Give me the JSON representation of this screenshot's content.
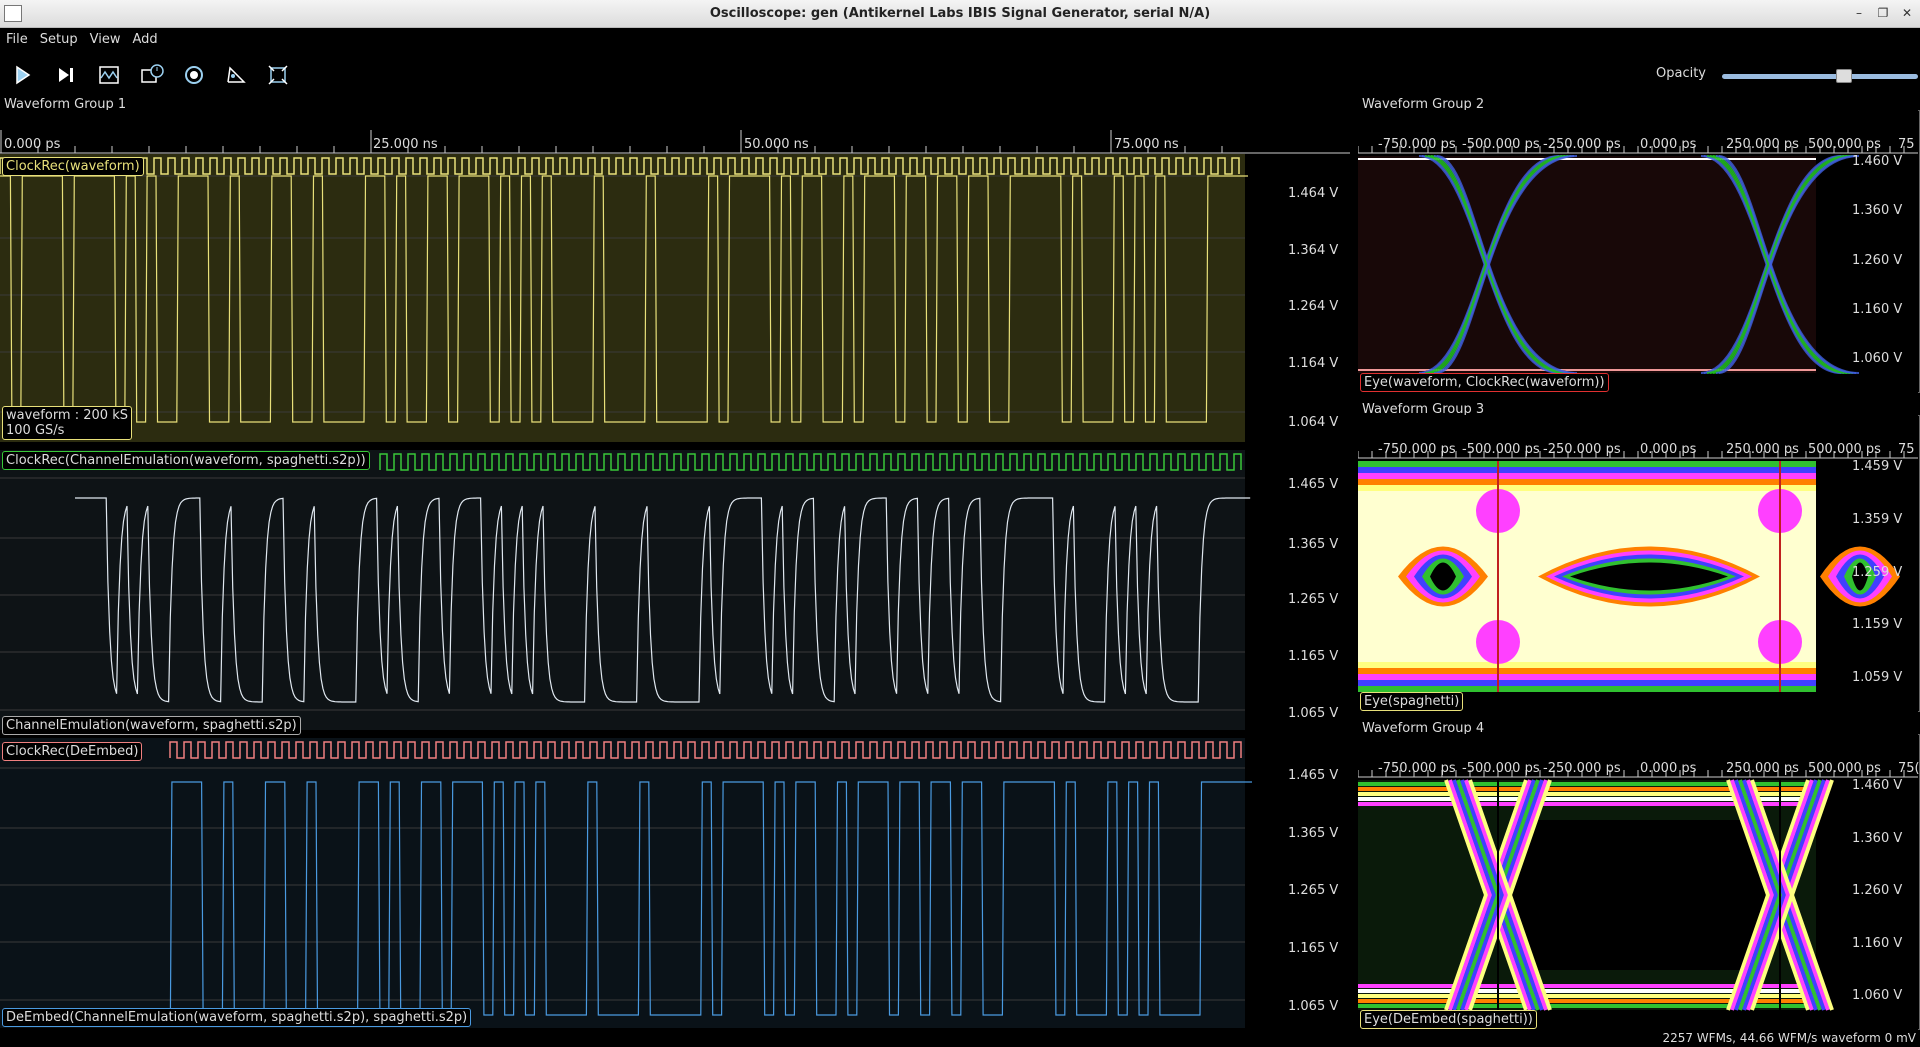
{
  "window": {
    "title": "Oscilloscope: gen (Antikernel Labs IBIS Signal Generator, serial N/A)"
  },
  "menu": [
    "File",
    "Setup",
    "View",
    "Add"
  ],
  "toolbar": {
    "buttons": [
      "play-icon",
      "step-icon",
      "waveform-icon",
      "clock-icon",
      "record-icon",
      "history-icon",
      "fullscreen-icon"
    ],
    "opacity_label": "Opacity",
    "opacity_value": 0.62
  },
  "colors": {
    "yellow": "#e8e07a",
    "green": "#38c838",
    "white": "#e0e8f0",
    "salmon": "#f08080",
    "blue": "#4a9ae0"
  },
  "group1": {
    "title": "Waveform Group 1",
    "time_labels": [
      "0.000 ps",
      "25.000 ns",
      "50.000 ns",
      "75.000 ns"
    ],
    "panes": [
      {
        "clock_label": "ClockRec(waveform)",
        "info_label_1": "waveform : 200 kS",
        "info_label_2": "100 GS/s",
        "volts": [
          "1.464 V",
          "1.364 V",
          "1.264 V",
          "1.164 V",
          "1.064 V"
        ]
      },
      {
        "clock_label": "ClockRec(ChannelEmulation(waveform, spaghetti.s2p))",
        "trace_label": "ChannelEmulation(waveform, spaghetti.s2p)",
        "volts": [
          "1.465 V",
          "1.365 V",
          "1.265 V",
          "1.165 V",
          "1.065 V"
        ]
      },
      {
        "clock_label": "ClockRec(DeEmbed)",
        "trace_label": "DeEmbed(ChannelEmulation(waveform, spaghetti.s2p), spaghetti.s2p)",
        "volts": [
          "1.465 V",
          "1.365 V",
          "1.265 V",
          "1.165 V",
          "1.065 V"
        ]
      }
    ]
  },
  "eye_groups": [
    {
      "title": "Waveform Group 2",
      "time_labels": [
        "-750.000 ps",
        "-500.000 ps",
        "-250.000 ps",
        "0.000 ps",
        "250.000 ps",
        "500.000 ps",
        "75"
      ],
      "volts": [
        "1.460 V",
        "1.360 V",
        "1.260 V",
        "1.160 V",
        "1.060 V"
      ],
      "label": "Eye(waveform, ClockRec(waveform))"
    },
    {
      "title": "Waveform Group 3",
      "time_labels": [
        "-750.000 ps",
        "-500.000 ps",
        "-250.000 ps",
        "0.000 ps",
        "250.000 ps",
        "500.000 ps",
        "75"
      ],
      "volts": [
        "1.459 V",
        "1.359 V",
        "1.259 V",
        "1.159 V",
        "1.059 V"
      ],
      "label": "Eye(spaghetti)"
    },
    {
      "title": "Waveform Group 4",
      "time_labels": [
        "-750.000 ps",
        "-500.000 ps",
        "-250.000 ps",
        "0.000 ps",
        "250.000 ps",
        "500.000 ps",
        "75("
      ],
      "volts": [
        "1.460 V",
        "1.360 V",
        "1.260 V",
        "1.160 V",
        "1.060 V"
      ],
      "label": "Eye(DeEmbed(spaghetti))"
    }
  ],
  "status": {
    "text": "2257 WFMs, 44.66 WFM/s  waveform 0 mV"
  }
}
